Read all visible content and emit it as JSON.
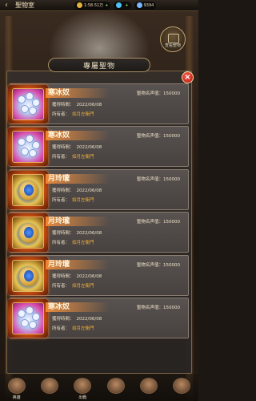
{
  "header": {
    "title": "聖物室",
    "back_icon": "back-arrow-icon",
    "resources": [
      {
        "icon": "gold-coin-icon",
        "value": "1:58.51万",
        "color": "#e2b33c"
      },
      {
        "icon": "diamond-icon",
        "value": "",
        "color": "#4fc3f7"
      },
      {
        "icon": "crystal-icon",
        "value": "9394",
        "color": "#7ab8ff"
      }
    ]
  },
  "treasure_button": {
    "label": "查看聖物",
    "icon": "relic-book-icon"
  },
  "panel": {
    "title": "專屬聖物",
    "close_icon": "close-icon",
    "labels": {
      "fame": "聖物名声值：",
      "acquired": "獲得時間：",
      "owner": "所有者："
    },
    "items": [
      {
        "name": "寒冰奴",
        "fame": "150000",
        "acquired": "2022/06/08",
        "owner": "如月左衛門",
        "image": "frost-flower-relic",
        "style": "pink"
      },
      {
        "name": "寒冰奴",
        "fame": "150000",
        "acquired": "2022/06/08",
        "owner": "如月左衛門",
        "image": "frost-flower-relic",
        "style": "pink"
      },
      {
        "name": "月玲瓏",
        "fame": "150000",
        "acquired": "2022/06/08",
        "owner": "如月左衛門",
        "image": "moon-orb-relic",
        "style": "gold"
      },
      {
        "name": "月玲瓏",
        "fame": "150000",
        "acquired": "2022/06/08",
        "owner": "如月左衛門",
        "image": "moon-orb-relic",
        "style": "gold"
      },
      {
        "name": "月玲瓏",
        "fame": "150000",
        "acquired": "2022/06/08",
        "owner": "如月左衛門",
        "image": "moon-orb-relic",
        "style": "gold"
      },
      {
        "name": "寒冰奴",
        "fame": "150000",
        "acquired": "2022/06/08",
        "owner": "如月左衛門",
        "image": "frost-flower-relic",
        "style": "pink"
      }
    ]
  },
  "bottom_nav": [
    {
      "label": "英雄",
      "icon": "hero-icon"
    },
    {
      "label": "",
      "icon": "team-icon"
    },
    {
      "label": "出戰",
      "icon": "battle-icon"
    },
    {
      "label": "",
      "icon": "cat-icon"
    },
    {
      "label": "",
      "icon": "shop-icon"
    },
    {
      "label": "",
      "icon": "menu-icon"
    }
  ]
}
